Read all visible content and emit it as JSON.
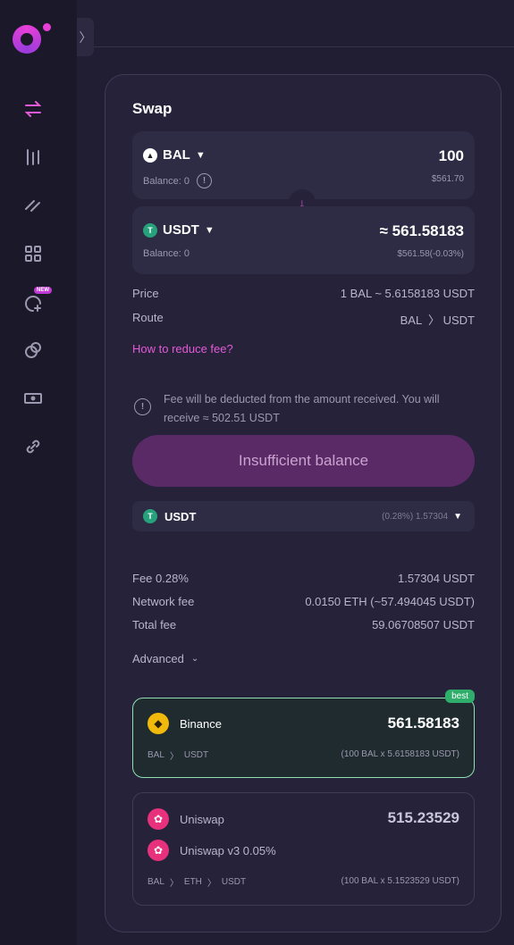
{
  "sidebar": {
    "collapse_icon": "chevron-right-icon",
    "items": [
      {
        "name": "swap",
        "icon": "arrows-swap-icon",
        "active": true
      },
      {
        "name": "chart",
        "icon": "candles-icon"
      },
      {
        "name": "bridge",
        "icon": "slashes-icon"
      },
      {
        "name": "dashboard",
        "icon": "grid-icon"
      },
      {
        "name": "launch",
        "icon": "add-circle-icon",
        "badge": "NEW"
      },
      {
        "name": "pools",
        "icon": "coins-icon"
      },
      {
        "name": "card",
        "icon": "card-icon"
      },
      {
        "name": "links",
        "icon": "link-icon"
      }
    ]
  },
  "swap": {
    "title": "Swap",
    "from": {
      "symbol": "BAL",
      "amount": "100",
      "balance": "Balance: 0",
      "usd": "$561.70"
    },
    "to": {
      "symbol": "USDT",
      "amount": "≈ 561.58183",
      "balance": "Balance: 0",
      "usd": "$561.58(-0.03%)"
    },
    "price_label": "Price",
    "price_value": "1 BAL ~ 5.6158183 USDT",
    "route_label": "Route",
    "route_from": "BAL",
    "route_to": "USDT",
    "fee_link": "How to reduce fee?",
    "notice": "Fee will be deducted from the amount received. You will receive ≈ 502.51 USDT",
    "cta": "Insufficient balance",
    "fee_token": {
      "symbol": "USDT",
      "detail": "(0.28%) 1.57304"
    },
    "fees": [
      {
        "label": "Fee 0.28%",
        "value": "1.57304 USDT"
      },
      {
        "label": "Network fee",
        "value": "0.0150 ETH (~57.494045 USDT)"
      },
      {
        "label": "Total fee",
        "value": "59.06708507 USDT"
      }
    ],
    "advanced": "Advanced"
  },
  "quotes": {
    "best_tag": "best",
    "binance": {
      "name": "Binance",
      "out": "561.58183",
      "path": [
        "BAL",
        "USDT"
      ],
      "calc": "(100 BAL x 5.6158183 USDT)"
    },
    "uniswap": {
      "name": "Uniswap",
      "name2": "Uniswap v3 0.05%",
      "out": "515.23529",
      "path": [
        "BAL",
        "ETH",
        "USDT"
      ],
      "calc": "(100 BAL x 5.1523529 USDT)"
    }
  },
  "colors": {
    "accent": "#e45ad6",
    "best": "#2fae6b",
    "usdt": "#26a17b",
    "binance": "#f0b90b",
    "uniswap": "#e8317c"
  }
}
